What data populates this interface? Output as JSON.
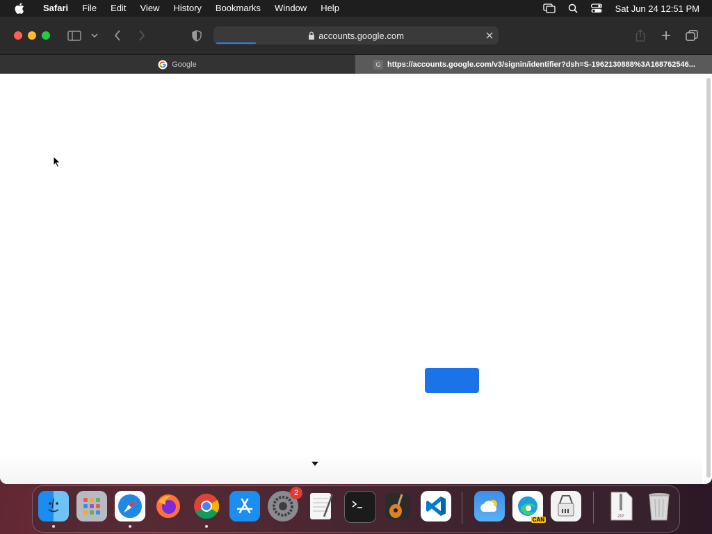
{
  "menubar": {
    "app_name": "Safari",
    "items": [
      "File",
      "Edit",
      "View",
      "History",
      "Bookmarks",
      "Window",
      "Help"
    ],
    "clock": "Sat Jun 24  12:51 PM",
    "icons": [
      "apple-icon",
      "screen-mirroring-icon",
      "spotlight-search-icon",
      "control-center-icon"
    ]
  },
  "toolbar": {
    "url": "accounts.google.com",
    "progress": 0.14
  },
  "tabs": [
    {
      "title": "Google",
      "favicon": "google-favicon",
      "active": false
    },
    {
      "title": "https://accounts.google.com/v3/signin/identifier?dsh=S-1962130888%3A168762546...",
      "favicon_letter": "G",
      "active": true
    }
  ],
  "content": {
    "button_color": "#1a73e8"
  },
  "dock": {
    "apps": [
      "Finder",
      "Launchpad",
      "Safari",
      "Firefox",
      "Google Chrome",
      "App Store",
      "System Settings",
      "TextEdit",
      "Terminal",
      "GarageBand",
      "Visual Studio Code",
      "iCloud",
      "Microsoft Edge Canary",
      "Archive Utility",
      "Zip Archive",
      "Trash"
    ],
    "settings_badge": "2",
    "edge_tag": "CAN"
  }
}
